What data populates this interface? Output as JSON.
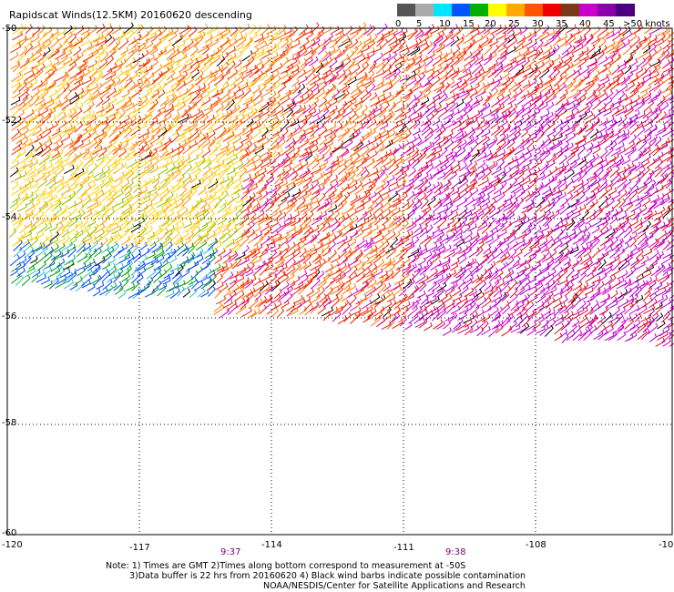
{
  "title": "Rapidscat Winds(12.5KM) 20160620 descending",
  "legend": {
    "colors": [
      "#555555",
      "#aaaaaa",
      "#00e5ff",
      "#0055ff",
      "#00b000",
      "#ffff00",
      "#ffaa00",
      "#ff5500",
      "#ee0000",
      "#7a3a1a",
      "#cc00cc",
      "#8a00aa",
      "#4b0080"
    ],
    "labels": [
      "0",
      "5",
      "10",
      "15",
      "20",
      "25",
      "30",
      "35",
      "40",
      "45",
      ">50 knots"
    ]
  },
  "map": {
    "lon_ticks": [
      "-120",
      "-117",
      "-114",
      "-111",
      "-108",
      "-10"
    ],
    "lat_ticks": [
      "-50",
      "-52",
      "-54",
      "-56",
      "-58",
      "-60"
    ]
  },
  "times": [
    "9:37",
    "9:38"
  ],
  "footnote": {
    "line1": "Note: 1) Times are GMT 2)Times along bottom correspond to measurement at -50S",
    "line2": "3)Data buffer is 22 hrs from 20160620 4) Black wind barbs indicate possible contamination",
    "line3": "NOAA/NESDIS/Center for Satellite Applications and Research"
  }
}
